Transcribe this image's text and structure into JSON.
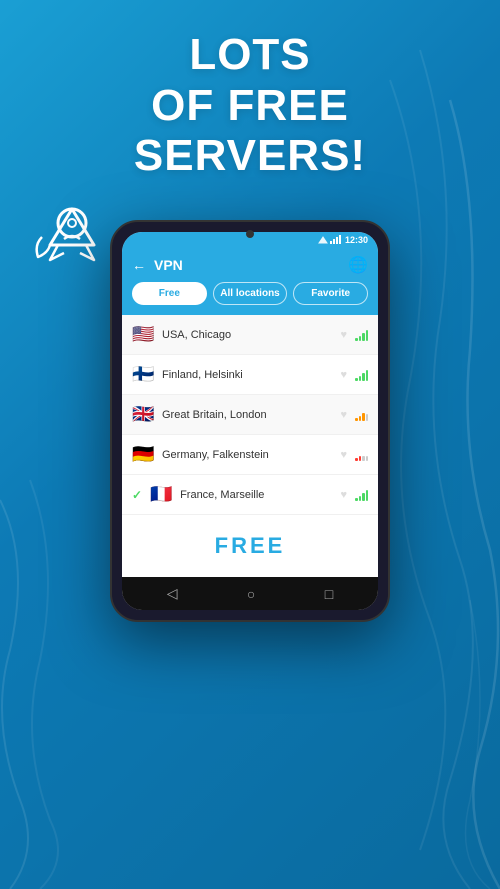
{
  "hero": {
    "line1": "Lots",
    "line2": "of free",
    "line3": "servers!"
  },
  "status_bar": {
    "time": "12:30"
  },
  "nav": {
    "title": "VPN",
    "back_icon": "←",
    "globe_icon": "🌐"
  },
  "tabs": [
    {
      "label": "Free",
      "active": true
    },
    {
      "label": "All locations",
      "active": false
    },
    {
      "label": "Favorite",
      "active": false
    }
  ],
  "servers": [
    {
      "flag": "🇺🇸",
      "name": "USA, Chicago",
      "selected": false,
      "signal_color": "#4cd964",
      "signal_bars": [
        3,
        5,
        7,
        9
      ]
    },
    {
      "flag": "🇫🇮",
      "name": "Finland, Helsinki",
      "selected": false,
      "signal_color": "#4cd964",
      "signal_bars": [
        3,
        5,
        7,
        9
      ]
    },
    {
      "flag": "🇬🇧",
      "name": "Great Britain, London",
      "selected": false,
      "signal_color": "#ff9500",
      "signal_bars": [
        3,
        5,
        7,
        6
      ]
    },
    {
      "flag": "🇩🇪",
      "name": "Germany, Falkenstein",
      "selected": false,
      "signal_color": "#ff3b30",
      "signal_bars": [
        3,
        5,
        4,
        4
      ]
    },
    {
      "flag": "🇫🇷",
      "name": "France, Marseille",
      "selected": true,
      "signal_color": "#4cd964",
      "signal_bars": [
        3,
        5,
        7,
        9
      ]
    }
  ],
  "free_label": "FREE",
  "phone_nav": {
    "back": "◁",
    "home": "○",
    "recent": "□"
  }
}
